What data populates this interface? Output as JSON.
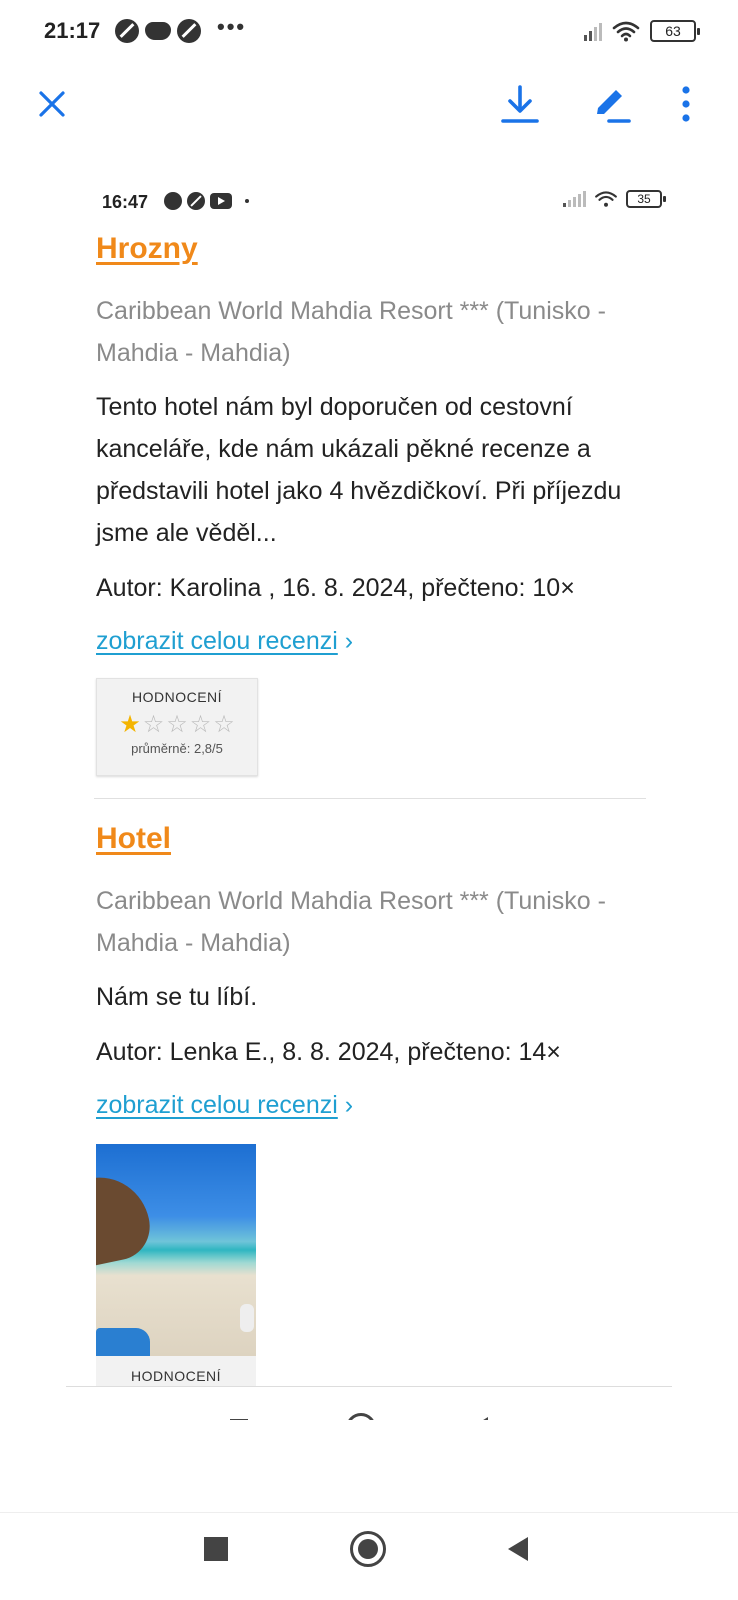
{
  "status_bar": {
    "time": "21:17",
    "more_indicator": "•••",
    "battery": "63"
  },
  "app_bar": {
    "close_icon": "close-icon",
    "download_icon": "download-icon",
    "edit_icon": "edit-icon",
    "more_icon": "more-vert-icon",
    "accent_color": "#1a73e8"
  },
  "embedded": {
    "status_bar": {
      "time": "16:47",
      "battery": "35"
    },
    "reviews": [
      {
        "title": "Hrozny",
        "hotel": "Caribbean World Mahdia Resort *** (Tunisko - Mahdia - Mahdia)",
        "text": "Tento hotel nám byl doporučen od cestovní kanceláře, kde nám ukázali pěkné recenze a představili hotel jako 4 hvězdičkoví. Při příjezdu jsme ale věděl...",
        "author": "Autor: Karolina , 16. 8. 2024, přečteno: 10×",
        "link": "zobrazit celou recenzi",
        "link_arrow": "›",
        "rating_label": "HODNOCENÍ",
        "rating_stars": 1,
        "rating_max": 5,
        "rating_avg": "průměrně: 2,8/5"
      },
      {
        "title": "Hotel",
        "hotel": "Caribbean World Mahdia Resort *** (Tunisko - Mahdia - Mahdia)",
        "text": "Nám se tu líbí.",
        "author": "Autor: Lenka E., 8. 8. 2024, přečteno: 14×",
        "link": "zobrazit celou recenzi",
        "link_arrow": "›",
        "rating_label": "HODNOCENÍ"
      }
    ]
  },
  "colors": {
    "title": "#f0891a",
    "link": "#1f9fd1",
    "muted": "#8a8a8a"
  }
}
